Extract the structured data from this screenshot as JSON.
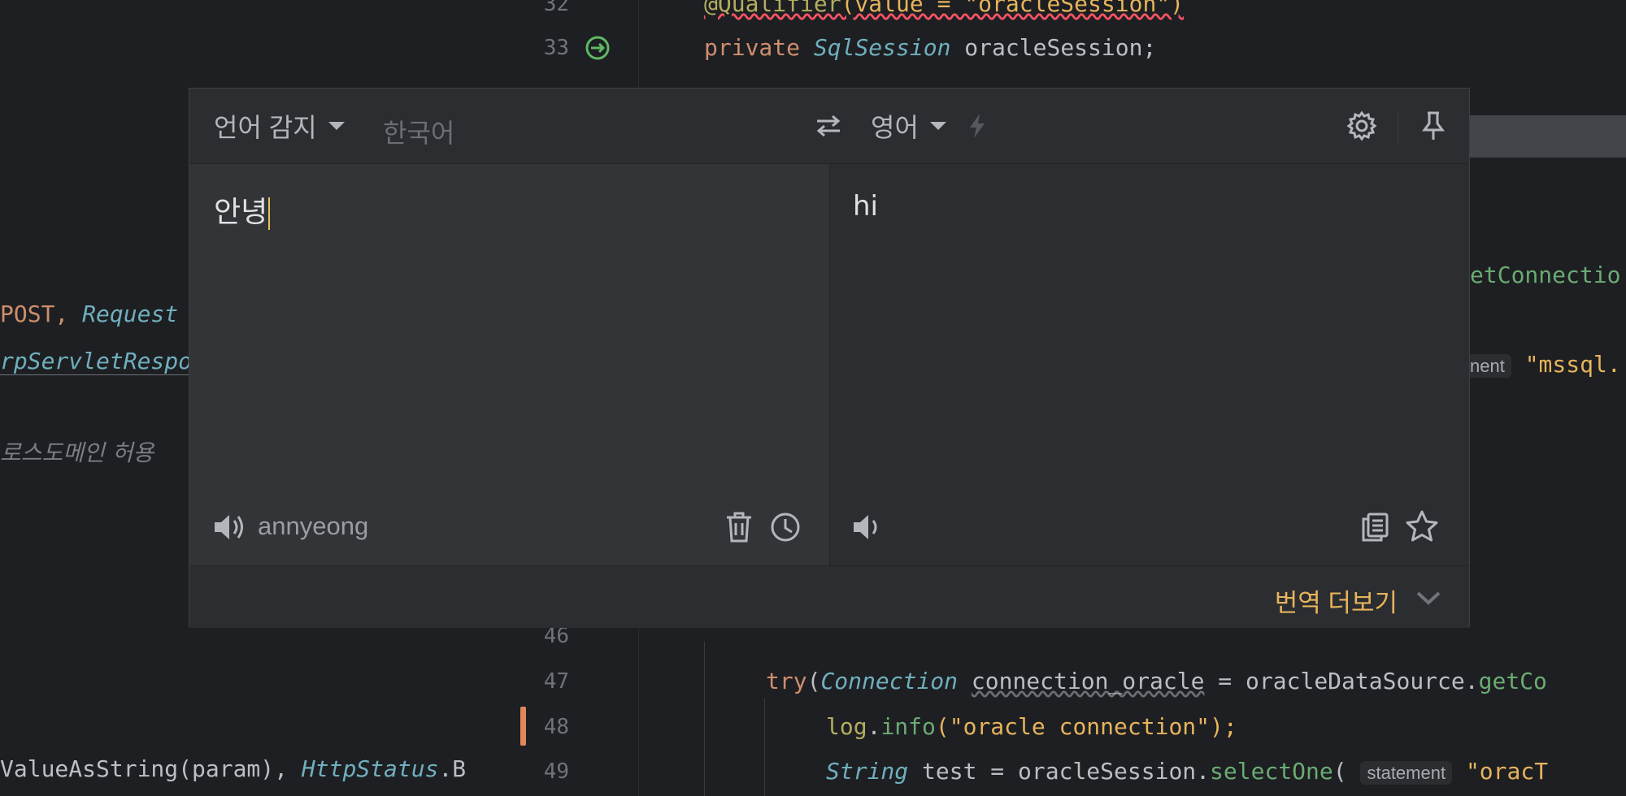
{
  "editor": {
    "line_numbers": [
      "32",
      "33",
      "46",
      "47",
      "48",
      "49"
    ],
    "lines": {
      "l32_annotation": "@Qualifier",
      "l32_rest": "(value = \"oracleSession\")",
      "l33_kw": "private",
      "l33_type": "SqlSession",
      "l33_name": " oracleSession;",
      "l47_try": "try",
      "l47_open": "(",
      "l47_type": "Connection",
      "l47_var": "connection_oracle",
      "l47_rest": " = oracleDataSource.",
      "l47_fn": "getCo",
      "l48_log": "log",
      "l48_dot": ".",
      "l48_fn": "info",
      "l48_str": "(\"oracle connection\");",
      "l49_type": "String",
      "l49_rest": " test = oracleSession.",
      "l49_fn": "selectOne",
      "l49_open": "(",
      "l49_hint": "statement",
      "l49_str": "\"oracT"
    },
    "right_frag_1": "etConnectio",
    "right_frag_2_hint": "nent",
    "right_frag_2_str": "\"mssql.",
    "left_frag_1a": "POST, ",
    "left_frag_1b": "Request",
    "left_frag_2": "rpServletRespo",
    "left_frag_3": "로스도메인 허용",
    "left_frag_4a": "ValueAsString(param), ",
    "left_frag_4b": "HttpStatus",
    "left_frag_4c": ".B"
  },
  "translator": {
    "source_lang_label": "언어 감지",
    "detected_lang": "한국어",
    "target_lang_label": "영어",
    "source_text": "안녕",
    "romanization": "annyeong",
    "translated_text": "hi",
    "more_label": "번역 더보기"
  },
  "icons": {
    "swap": "swap-arrows-icon",
    "flash": "lightning-icon",
    "settings": "gear-icon",
    "pin": "pin-icon",
    "speaker": "speaker-icon",
    "delete": "trash-icon",
    "history": "clock-icon",
    "copy": "copy-icon",
    "favorite": "star-icon",
    "expand": "chevron-down-icon"
  },
  "colors": {
    "accent": "#e6b45c",
    "popup_bg": "#2b2d30",
    "source_pane_bg": "#333437"
  }
}
